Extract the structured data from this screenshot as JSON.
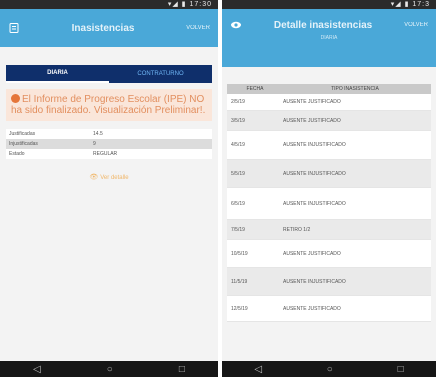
{
  "left": {
    "status_time": "▾◢ ▮ 17:30",
    "appbar": {
      "title": "Inasistencias",
      "action": "VOLVER",
      "icon": "list-icon"
    },
    "tabs": [
      {
        "label": "DIARIA"
      },
      {
        "label": "CONTRATURNO"
      }
    ],
    "notice": "El Informe de Progreso Escolar (IPE) NO ha sido finalizado. Visualización Preliminar!.",
    "stats": [
      {
        "label": "Justificadas",
        "value": "14.5"
      },
      {
        "label": "Injustificadas",
        "value": "9"
      },
      {
        "label": "Estado",
        "value": "REGULAR"
      }
    ],
    "detail_link": "Ver detalle",
    "nav": {
      "back": "◁",
      "home": "○",
      "recent": "□"
    }
  },
  "right": {
    "status_time": "▾◢ ▮ 17:3",
    "appbar": {
      "title": "Detalle inasistencias",
      "action": "VOLVER",
      "subtitle": "DIARIA",
      "icon": "eye-icon"
    },
    "table": {
      "headers": [
        "FECHA",
        "TIPO INASISTENCIA"
      ],
      "rows": [
        [
          "2/5/19",
          "AUSENTE JUSTIFICADO"
        ],
        [
          "3/5/19",
          "AUSENTE JUSTIFICADO"
        ],
        [
          "4/5/19",
          "AUSENTE INJUSTIFICADO"
        ],
        [
          "5/5/19",
          "AUSENTE INJUSTIFICADO"
        ],
        [
          "6/5/19",
          "AUSENTE INJUSTIFICADO"
        ],
        [
          "7/5/19",
          "RETIRO 1/2"
        ],
        [
          "10/5/19",
          "AUSENTE JUSTIFICADO"
        ],
        [
          "11/5/19",
          "AUSENTE INJUSTIFICADO"
        ],
        [
          "12/5/19",
          "AUSENTE JUSTIFICADO"
        ]
      ]
    },
    "nav": {
      "back": "◁",
      "home": "○",
      "recent": "□"
    }
  }
}
